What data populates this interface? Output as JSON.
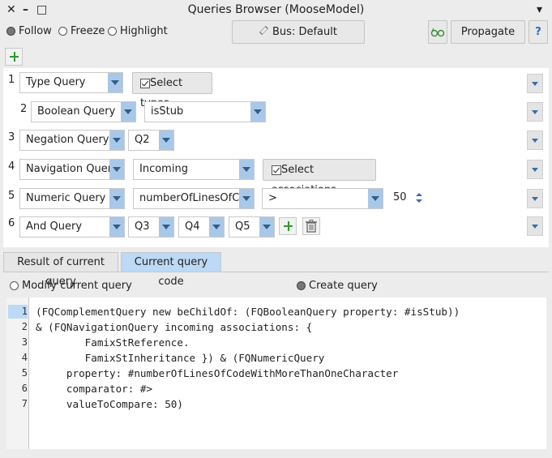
{
  "window": {
    "title": "Queries Browser (MooseModel)",
    "close_glyph": "✕",
    "minimize_glyph": "–",
    "maximize_glyph": "□",
    "menu_glyph": "▾"
  },
  "toolbar": {
    "follow": "Follow",
    "freeze": "Freeze",
    "highlight": "Highlight",
    "selected_mode": "Follow",
    "bus_label": "Bus: Default",
    "propagate": "Propagate",
    "help": "?"
  },
  "queries": [
    {
      "num": "1",
      "type": "Type Query",
      "checkbox_label": "Select types",
      "checked": true
    },
    {
      "num": "2",
      "type": "Boolean Query",
      "property": "isStub"
    },
    {
      "num": "3",
      "type": "Negation Query",
      "child": "Q2"
    },
    {
      "num": "4",
      "type": "Navigation Query",
      "direction": "Incoming",
      "checkbox_label": "Select associations",
      "checked": true
    },
    {
      "num": "5",
      "type": "Numeric Query",
      "property": "numberOfLinesOfCode",
      "comparator": ">",
      "value": "50"
    },
    {
      "num": "6",
      "type": "And Query",
      "children": [
        "Q3",
        "Q4",
        "Q5"
      ]
    }
  ],
  "tabs": [
    "Result of current query",
    "Current query code"
  ],
  "active_tab": "Current query code",
  "modes": {
    "modify": "Modify current query",
    "create": "Create query",
    "selected": "Create query"
  },
  "code": {
    "current_line": 1,
    "lines": [
      "(FQComplementQuery new beChildOf: (FQBooleanQuery property: #isStub))",
      "& (FQNavigationQuery incoming associations: {",
      "        FamixStReference.",
      "        FamixStInheritance }) & (FQNumericQuery",
      "     property: #numberOfLinesOfCodeWithMoreThanOneCharacter",
      "     comparator: #>",
      "     valueToCompare: 50)"
    ],
    "line_numbers": [
      "1",
      "2",
      "3",
      "4",
      "5",
      "6",
      "7"
    ]
  }
}
